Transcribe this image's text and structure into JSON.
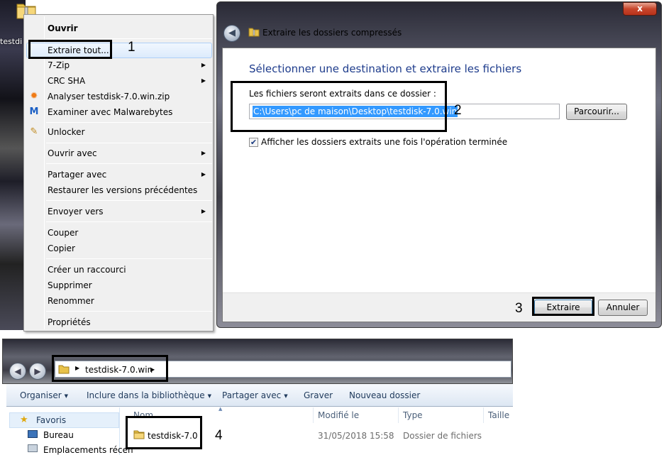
{
  "desktop": {
    "icon_label": "testdi"
  },
  "context_menu": {
    "items": [
      {
        "label": "Ouvrir"
      },
      {
        "label": "Extraire tout..."
      },
      {
        "label": "7-Zip"
      },
      {
        "label": "CRC SHA"
      },
      {
        "label": "Analyser testdisk-7.0.win.zip"
      },
      {
        "label": "Examiner avec Malwarebytes"
      },
      {
        "label": "Unlocker"
      },
      {
        "label": "Ouvrir avec"
      },
      {
        "label": "Partager avec"
      },
      {
        "label": "Restaurer les versions précédentes"
      },
      {
        "label": "Envoyer vers"
      },
      {
        "label": "Couper"
      },
      {
        "label": "Copier"
      },
      {
        "label": "Créer un raccourci"
      },
      {
        "label": "Supprimer"
      },
      {
        "label": "Renommer"
      },
      {
        "label": "Propriétés"
      }
    ]
  },
  "annotations": {
    "step1": "1",
    "step2": "2",
    "step3": "3",
    "step4": "4"
  },
  "dialog": {
    "title": "Extraire les dossiers compressés",
    "close_label": "x",
    "heading": "Sélectionner une destination et extraire les fichiers",
    "field_label": "Les fichiers seront extraits dans ce dossier :",
    "path_value": "C:\\Users\\pc de maison\\Desktop\\testdisk-7.0.win",
    "browse_label": "Parcourir...",
    "checkbox_label": "Afficher les dossiers extraits une fois l'opération terminée",
    "checkbox_checked": true,
    "extract_label": "Extraire",
    "cancel_label": "Annuler"
  },
  "explorer": {
    "address": "testdisk-7.0.win",
    "toolbar": {
      "organize": "Organiser",
      "include": "Inclure dans la bibliothèque",
      "share": "Partager avec",
      "burn": "Graver",
      "new_folder": "Nouveau dossier"
    },
    "nav": {
      "favorites": "Favoris",
      "desktop": "Bureau",
      "recent": "Emplacements récen"
    },
    "columns": {
      "name": "Nom",
      "modified": "Modifié le",
      "type": "Type",
      "size": "Taille"
    },
    "rows": [
      {
        "name": "testdisk-7.0",
        "modified": "31/05/2018 15:58",
        "type": "Dossier de fichiers"
      }
    ]
  },
  "colors": {
    "accent_heading": "#1e3c8c",
    "selection": "#3399ff"
  }
}
